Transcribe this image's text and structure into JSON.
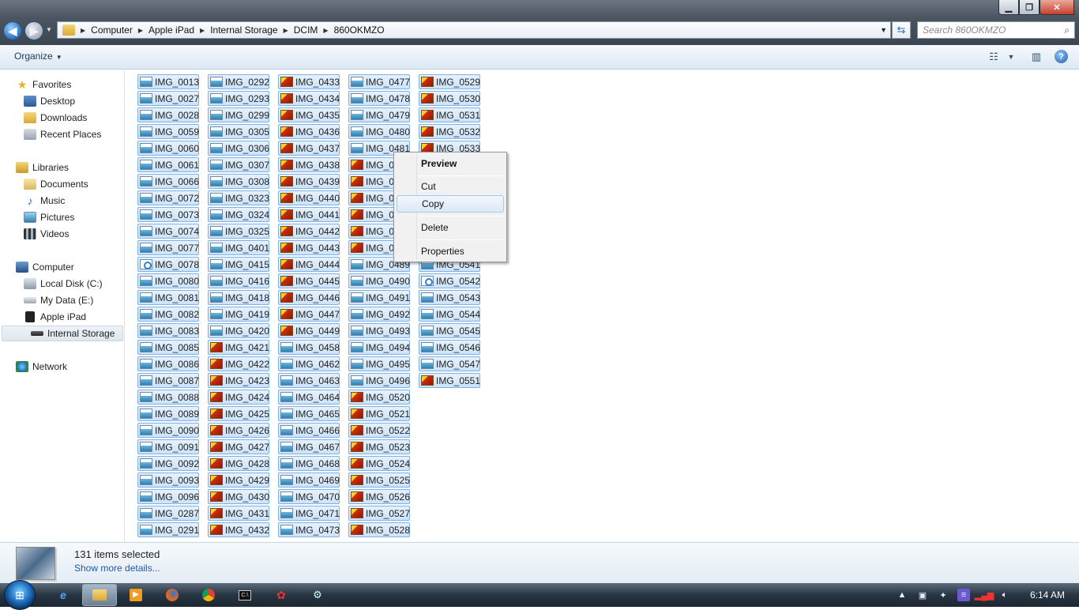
{
  "window": {
    "min_label": "▁",
    "max_label": "❐",
    "close_label": "✕"
  },
  "address": {
    "crumbs": [
      "Computer",
      "Apple iPad",
      "Internal Storage",
      "DCIM",
      "860OKMZO"
    ]
  },
  "search": {
    "placeholder": "Search 860OKMZO"
  },
  "toolbar": {
    "organize_label": "Organize",
    "help_label": "?"
  },
  "nav": {
    "favorites": "Favorites",
    "desktop": "Desktop",
    "downloads": "Downloads",
    "recent_places": "Recent Places",
    "libraries": "Libraries",
    "documents": "Documents",
    "music": "Music",
    "pictures": "Pictures",
    "videos": "Videos",
    "computer": "Computer",
    "local_disk": "Local Disk (C:)",
    "my_data": "My Data (E:)",
    "apple_ipad": "Apple iPad",
    "internal_storage": "Internal Storage",
    "network": "Network"
  },
  "files": {
    "columns": [
      [
        {
          "n": "IMG_0013",
          "t": "img"
        },
        {
          "n": "IMG_0027",
          "t": "img"
        },
        {
          "n": "IMG_0028",
          "t": "img"
        },
        {
          "n": "IMG_0059",
          "t": "img"
        },
        {
          "n": "IMG_0060",
          "t": "img"
        },
        {
          "n": "IMG_0061",
          "t": "img"
        },
        {
          "n": "IMG_0066",
          "t": "img"
        },
        {
          "n": "IMG_0072",
          "t": "img"
        },
        {
          "n": "IMG_0073",
          "t": "img"
        },
        {
          "n": "IMG_0074",
          "t": "img"
        },
        {
          "n": "IMG_0077",
          "t": "img"
        },
        {
          "n": "IMG_0078",
          "t": "doc"
        },
        {
          "n": "IMG_0080",
          "t": "img"
        },
        {
          "n": "IMG_0081",
          "t": "img"
        },
        {
          "n": "IMG_0082",
          "t": "img"
        },
        {
          "n": "IMG_0083",
          "t": "img"
        },
        {
          "n": "IMG_0085",
          "t": "img"
        },
        {
          "n": "IMG_0086",
          "t": "img"
        },
        {
          "n": "IMG_0087",
          "t": "img"
        },
        {
          "n": "IMG_0088",
          "t": "img"
        },
        {
          "n": "IMG_0089",
          "t": "img"
        },
        {
          "n": "IMG_0090",
          "t": "img"
        },
        {
          "n": "IMG_0091",
          "t": "img"
        },
        {
          "n": "IMG_0092",
          "t": "img"
        },
        {
          "n": "IMG_0093",
          "t": "img"
        },
        {
          "n": "IMG_0096",
          "t": "img"
        },
        {
          "n": "IMG_0287",
          "t": "img"
        },
        {
          "n": "IMG_0291",
          "t": "img"
        }
      ],
      [
        {
          "n": "IMG_0292",
          "t": "img"
        },
        {
          "n": "IMG_0293",
          "t": "img"
        },
        {
          "n": "IMG_0299",
          "t": "img"
        },
        {
          "n": "IMG_0305",
          "t": "img"
        },
        {
          "n": "IMG_0306",
          "t": "img"
        },
        {
          "n": "IMG_0307",
          "t": "img"
        },
        {
          "n": "IMG_0308",
          "t": "img"
        },
        {
          "n": "IMG_0323",
          "t": "img"
        },
        {
          "n": "IMG_0324",
          "t": "img"
        },
        {
          "n": "IMG_0325",
          "t": "img"
        },
        {
          "n": "IMG_0401",
          "t": "img"
        },
        {
          "n": "IMG_0415",
          "t": "img"
        },
        {
          "n": "IMG_0416",
          "t": "img"
        },
        {
          "n": "IMG_0418",
          "t": "img"
        },
        {
          "n": "IMG_0419",
          "t": "img"
        },
        {
          "n": "IMG_0420",
          "t": "img"
        },
        {
          "n": "IMG_0421",
          "t": "mov"
        },
        {
          "n": "IMG_0422",
          "t": "mov"
        },
        {
          "n": "IMG_0423",
          "t": "mov"
        },
        {
          "n": "IMG_0424",
          "t": "mov"
        },
        {
          "n": "IMG_0425",
          "t": "mov"
        },
        {
          "n": "IMG_0426",
          "t": "mov"
        },
        {
          "n": "IMG_0427",
          "t": "mov"
        },
        {
          "n": "IMG_0428",
          "t": "mov"
        },
        {
          "n": "IMG_0429",
          "t": "mov"
        },
        {
          "n": "IMG_0430",
          "t": "mov"
        },
        {
          "n": "IMG_0431",
          "t": "mov"
        },
        {
          "n": "IMG_0432",
          "t": "mov"
        }
      ],
      [
        {
          "n": "IMG_0433",
          "t": "mov"
        },
        {
          "n": "IMG_0434",
          "t": "mov"
        },
        {
          "n": "IMG_0435",
          "t": "mov"
        },
        {
          "n": "IMG_0436",
          "t": "mov"
        },
        {
          "n": "IMG_0437",
          "t": "mov"
        },
        {
          "n": "IMG_0438",
          "t": "mov"
        },
        {
          "n": "IMG_0439",
          "t": "mov"
        },
        {
          "n": "IMG_0440",
          "t": "mov"
        },
        {
          "n": "IMG_0441",
          "t": "mov"
        },
        {
          "n": "IMG_0442",
          "t": "mov"
        },
        {
          "n": "IMG_0443",
          "t": "mov"
        },
        {
          "n": "IMG_0444",
          "t": "mov"
        },
        {
          "n": "IMG_0445",
          "t": "mov"
        },
        {
          "n": "IMG_0446",
          "t": "mov"
        },
        {
          "n": "IMG_0447",
          "t": "mov"
        },
        {
          "n": "IMG_0449",
          "t": "mov"
        },
        {
          "n": "IMG_0458",
          "t": "img"
        },
        {
          "n": "IMG_0462",
          "t": "img"
        },
        {
          "n": "IMG_0463",
          "t": "img"
        },
        {
          "n": "IMG_0464",
          "t": "img"
        },
        {
          "n": "IMG_0465",
          "t": "img"
        },
        {
          "n": "IMG_0466",
          "t": "img"
        },
        {
          "n": "IMG_0467",
          "t": "img"
        },
        {
          "n": "IMG_0468",
          "t": "img"
        },
        {
          "n": "IMG_0469",
          "t": "img"
        },
        {
          "n": "IMG_0470",
          "t": "img"
        },
        {
          "n": "IMG_0471",
          "t": "img"
        },
        {
          "n": "IMG_0473",
          "t": "img"
        }
      ],
      [
        {
          "n": "IMG_0477",
          "t": "img"
        },
        {
          "n": "IMG_0478",
          "t": "img"
        },
        {
          "n": "IMG_0479",
          "t": "img"
        },
        {
          "n": "IMG_0480",
          "t": "img"
        },
        {
          "n": "IMG_0481",
          "t": "img"
        },
        {
          "n": "IMG_04",
          "t": "mov"
        },
        {
          "n": "IMG_04",
          "t": "mov"
        },
        {
          "n": "IMG_04",
          "t": "mov"
        },
        {
          "n": "IMG_04",
          "t": "mov"
        },
        {
          "n": "IMG_04",
          "t": "mov"
        },
        {
          "n": "IMG_04",
          "t": "mov"
        },
        {
          "n": "IMG_0489",
          "t": "img"
        },
        {
          "n": "IMG_0490",
          "t": "img"
        },
        {
          "n": "IMG_0491",
          "t": "img"
        },
        {
          "n": "IMG_0492",
          "t": "img"
        },
        {
          "n": "IMG_0493",
          "t": "img"
        },
        {
          "n": "IMG_0494",
          "t": "img"
        },
        {
          "n": "IMG_0495",
          "t": "img"
        },
        {
          "n": "IMG_0496",
          "t": "img"
        },
        {
          "n": "IMG_0520",
          "t": "mov"
        },
        {
          "n": "IMG_0521",
          "t": "mov"
        },
        {
          "n": "IMG_0522",
          "t": "mov"
        },
        {
          "n": "IMG_0523",
          "t": "mov"
        },
        {
          "n": "IMG_0524",
          "t": "mov"
        },
        {
          "n": "IMG_0525",
          "t": "mov"
        },
        {
          "n": "IMG_0526",
          "t": "mov"
        },
        {
          "n": "IMG_0527",
          "t": "mov"
        },
        {
          "n": "IMG_0528",
          "t": "mov"
        }
      ],
      [
        {
          "n": "IMG_0529",
          "t": "mov"
        },
        {
          "n": "IMG_0530",
          "t": "mov"
        },
        {
          "n": "IMG_0531",
          "t": "mov"
        },
        {
          "n": "IMG_0532",
          "t": "mov"
        },
        {
          "n": "IMG_0533",
          "t": "mov"
        },
        {
          "n": "",
          "t": "hidden"
        },
        {
          "n": "",
          "t": "hidden"
        },
        {
          "n": "",
          "t": "hidden"
        },
        {
          "n": "",
          "t": "hidden"
        },
        {
          "n": "",
          "t": "hidden"
        },
        {
          "n": "",
          "t": "hidden"
        },
        {
          "n": "IMG_0541",
          "t": "img"
        },
        {
          "n": "IMG_0542",
          "t": "doc"
        },
        {
          "n": "IMG_0543",
          "t": "img"
        },
        {
          "n": "IMG_0544",
          "t": "img"
        },
        {
          "n": "IMG_0545",
          "t": "img"
        },
        {
          "n": "IMG_0546",
          "t": "img"
        },
        {
          "n": "IMG_0547",
          "t": "img"
        },
        {
          "n": "IMG_0551",
          "t": "mov"
        }
      ]
    ]
  },
  "context_menu": {
    "preview": "Preview",
    "cut": "Cut",
    "copy": "Copy",
    "delete": "Delete",
    "properties": "Properties"
  },
  "details": {
    "selected": "131 items selected",
    "more": "Show more details..."
  },
  "taskbar": {
    "start_label": "⊞",
    "clock": "6:14 AM"
  }
}
